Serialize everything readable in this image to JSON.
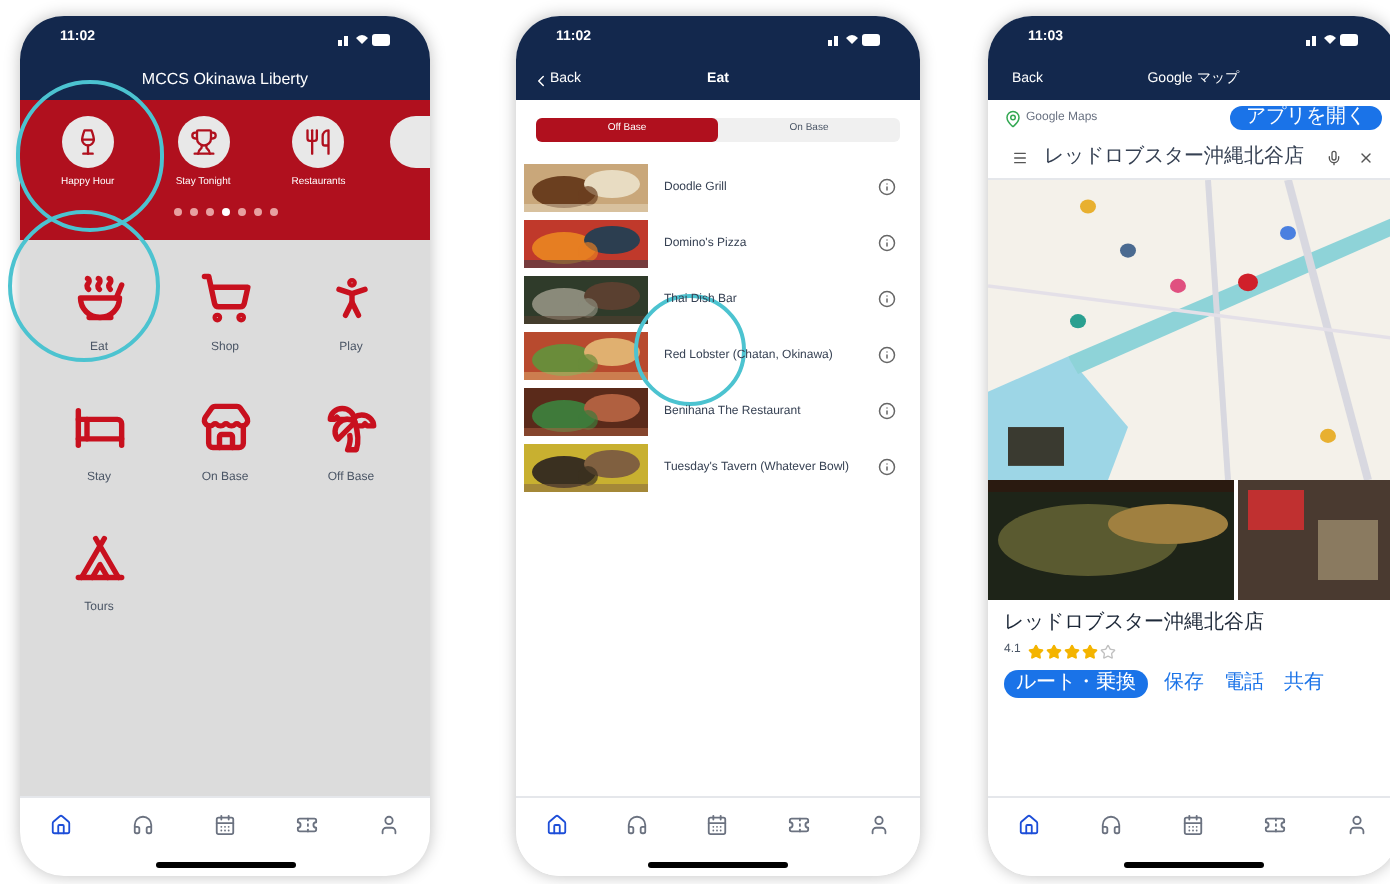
{
  "home_phone": {
    "status_time": "11:02",
    "title": "MCCS Okinawa Liberty",
    "carousel": [
      {
        "label": "Happy Hour"
      },
      {
        "label": "Stay Tonight"
      },
      {
        "label": "Restaurants"
      }
    ],
    "page_dots": [
      {
        "selected": false
      },
      {
        "selected": false
      },
      {
        "selected": false
      },
      {
        "selected": true
      },
      {
        "selected": false
      },
      {
        "selected": false
      },
      {
        "selected": false
      }
    ],
    "grid": [
      {
        "label": "Eat"
      },
      {
        "label": "Shop"
      },
      {
        "label": "Play"
      },
      {
        "label": "Stay"
      },
      {
        "label": "On Base"
      },
      {
        "label": "Off Base"
      },
      {
        "label": "Tours"
      }
    ],
    "tabs": [
      {
        "selected": true
      },
      {
        "selected": false
      },
      {
        "selected": false
      },
      {
        "selected": false
      },
      {
        "selected": false
      }
    ]
  },
  "list_phone": {
    "status_time": "11:02",
    "back": "Back",
    "title": "Eat",
    "segments": [
      {
        "label": "Off Base",
        "selected": true
      },
      {
        "label": "On Base",
        "selected": false
      }
    ],
    "restaurants": [
      {
        "name": "Doodle Grill"
      },
      {
        "name": "Domino's Pizza"
      },
      {
        "name": "Thai Dish Bar"
      },
      {
        "name": "Red Lobster (Chatan, Okinawa)"
      },
      {
        "name": "Benihana The Restaurant"
      },
      {
        "name": "Tuesday's Tavern (Whatever Bowl)"
      }
    ],
    "tabs": [
      {
        "selected": true
      },
      {
        "selected": false
      },
      {
        "selected": false
      },
      {
        "selected": false
      },
      {
        "selected": false
      }
    ]
  },
  "map_phone": {
    "status_time": "11:03",
    "back": "Back",
    "title": "Google マップ",
    "brand": "Google Maps",
    "open_app": "アプリを開く",
    "search": "レッドロブスター沖縄北谷店",
    "place_name": "レッドロブスター沖縄北谷店",
    "rating": "4.1",
    "stars": 4,
    "actions": [
      {
        "label": "ルート・乗換",
        "selected": true
      },
      {
        "label": "保存",
        "selected": false
      },
      {
        "label": "電話",
        "selected": false
      },
      {
        "label": "共有",
        "selected": false
      }
    ],
    "tabs": [
      {
        "selected": true
      },
      {
        "selected": false
      },
      {
        "selected": false
      },
      {
        "selected": false
      },
      {
        "selected": false
      }
    ]
  }
}
